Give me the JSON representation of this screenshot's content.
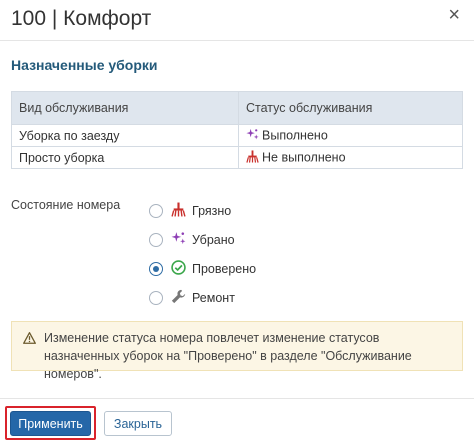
{
  "dialog": {
    "title": "100 | Комфорт",
    "close_glyph": "×"
  },
  "assigned": {
    "title": "Назначенные уборки",
    "columns": [
      "Вид обслуживания",
      "Статус обслуживания"
    ],
    "rows": [
      {
        "type": "Уборка по заезду",
        "status": "Выполнено",
        "status_icon": "sparkles-icon",
        "status_color": "#8e3fb5"
      },
      {
        "type": "Просто уборка",
        "status": "Не выполнено",
        "status_icon": "broom-icon",
        "status_color": "#c9302c"
      }
    ]
  },
  "room_state": {
    "label": "Состояние номера",
    "options": [
      {
        "label": "Грязно",
        "icon": "broom-icon",
        "color": "#c9302c",
        "checked": false
      },
      {
        "label": "Убрано",
        "icon": "sparkles-icon",
        "color": "#8e3fb5",
        "checked": false
      },
      {
        "label": "Проверено",
        "icon": "check-circle-icon",
        "color": "#3aa64a",
        "checked": true
      },
      {
        "label": "Ремонт",
        "icon": "wrench-icon",
        "color": "#777777",
        "checked": false
      }
    ]
  },
  "notice": {
    "icon": "warning-icon",
    "text": "Изменение статуса номера повлечет изменение статусов назначенных уборок на \"Проверено\" в разделе \"Обслуживание номеров\"."
  },
  "footer": {
    "apply_label": "Применить",
    "close_label": "Закрыть"
  }
}
